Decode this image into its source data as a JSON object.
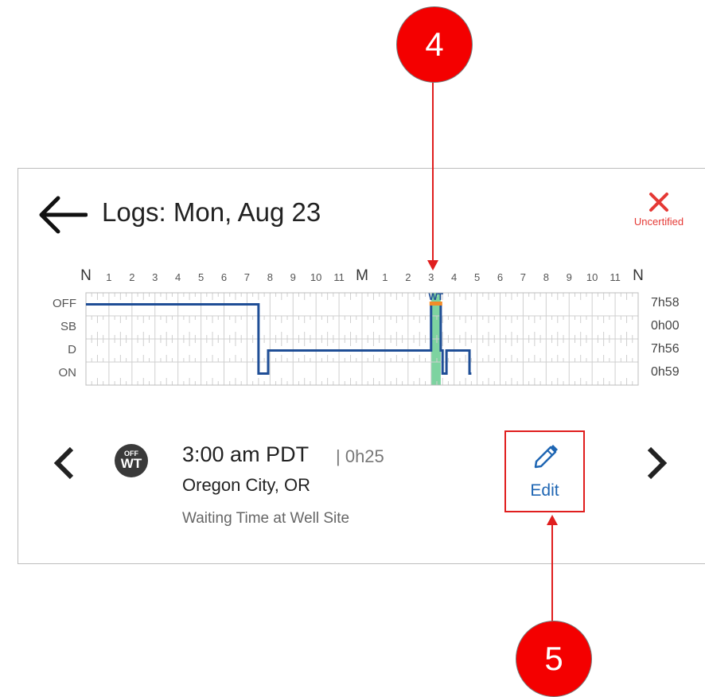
{
  "header": {
    "title": "Logs: Mon, Aug 23",
    "uncertified_label": "Uncertified"
  },
  "chart_data": {
    "type": "line",
    "title": "",
    "hour_labels": [
      "N",
      "1",
      "2",
      "3",
      "4",
      "5",
      "6",
      "7",
      "8",
      "9",
      "10",
      "11",
      "M",
      "1",
      "2",
      "3",
      "4",
      "5",
      "6",
      "7",
      "8",
      "9",
      "10",
      "11",
      "N"
    ],
    "rows": [
      "OFF",
      "SB",
      "D",
      "ON"
    ],
    "totals": [
      "7h58",
      "0h00",
      "7h56",
      "0h59"
    ],
    "marker_label": "WT",
    "status_segments": [
      {
        "status": "OFF",
        "start_hour": 0.0,
        "end_hour": 7.5
      },
      {
        "status": "ON",
        "start_hour": 7.5,
        "end_hour": 7.92
      },
      {
        "status": "D",
        "start_hour": 7.92,
        "end_hour": 15.0
      },
      {
        "status": "OFF",
        "start_hour": 15.0,
        "end_hour": 15.42
      },
      {
        "status": "D",
        "start_hour": 15.42,
        "end_hour": 15.5
      },
      {
        "status": "ON",
        "start_hour": 15.5,
        "end_hour": 15.67
      },
      {
        "status": "D",
        "start_hour": 15.67,
        "end_hour": 16.67
      },
      {
        "status": "ON",
        "start_hour": 16.67,
        "end_hour": 16.75
      }
    ],
    "highlight": {
      "start_hour": 15.0,
      "end_hour": 15.42,
      "color": "#7dd3a0"
    },
    "colors": {
      "line": "#1f4e96",
      "marker": "#f28c28",
      "highlight": "#7dd3a0"
    }
  },
  "event": {
    "icon_top": "OFF",
    "icon_bottom": "WT",
    "time": "3:00 am PDT",
    "duration": "| 0h25",
    "location": "Oregon City, OR",
    "description": "Waiting Time at Well Site",
    "edit_label": "Edit"
  },
  "callouts": {
    "top": "4",
    "bottom": "5"
  },
  "icons": {
    "back": "arrow-left-icon",
    "uncertified": "close-x-icon",
    "prev": "chevron-left-icon",
    "next": "chevron-right-icon",
    "edit": "pencil-icon"
  },
  "colors": {
    "accent_blue": "#1f66b3",
    "alert_red": "#e53935",
    "callout_red": "#f40000"
  }
}
